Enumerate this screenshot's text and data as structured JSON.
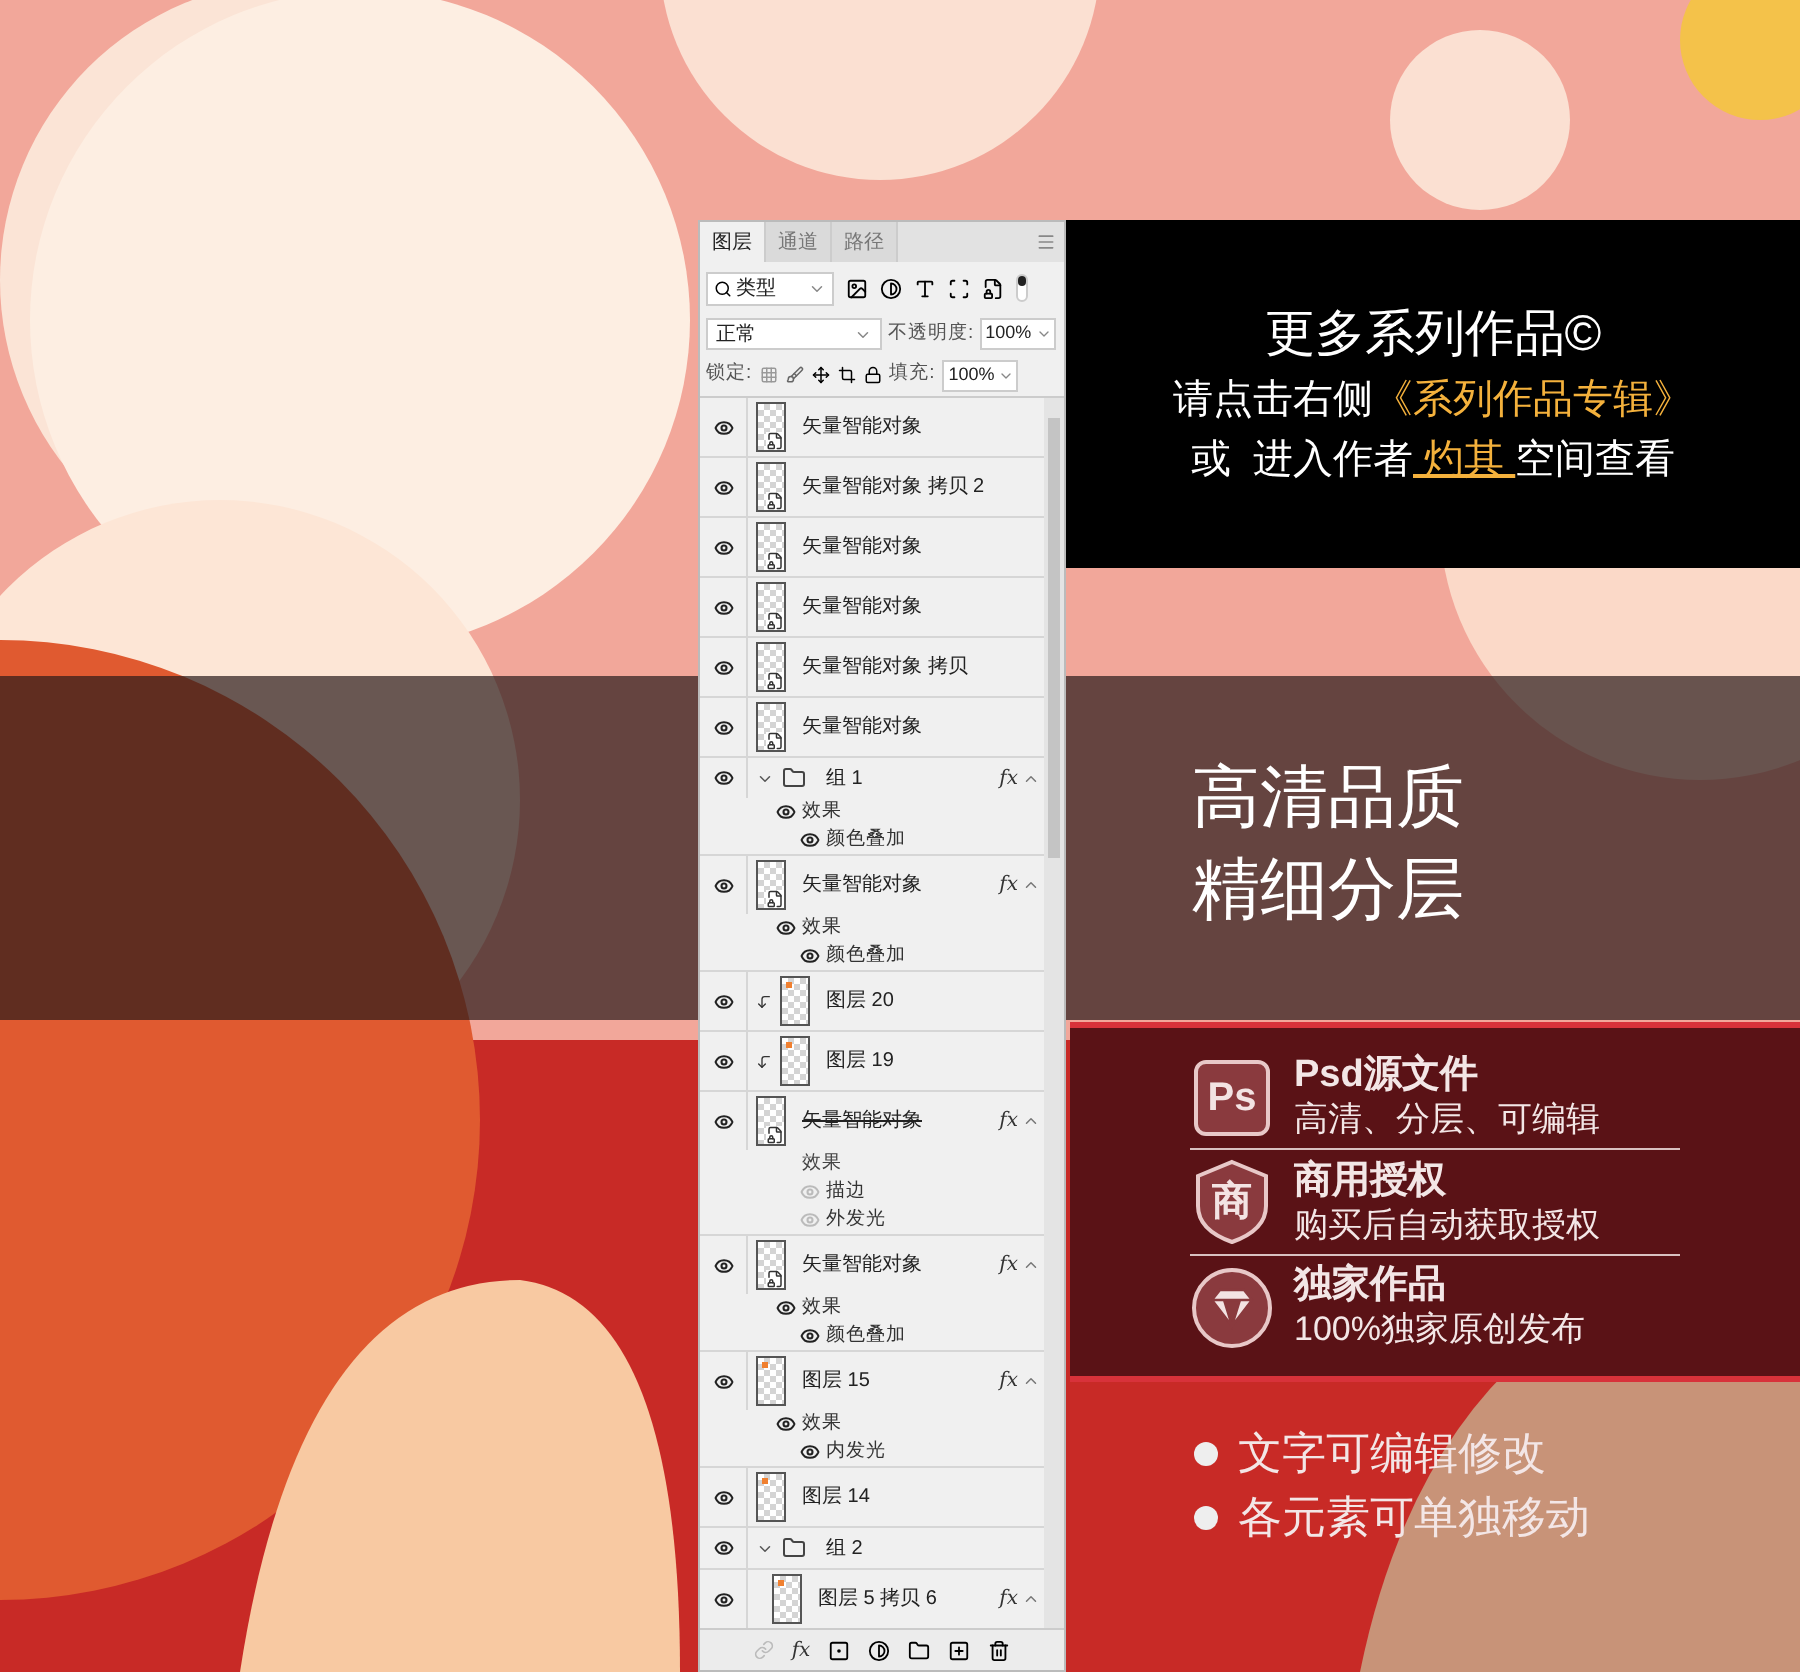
{
  "layers_panel": {
    "tabs": [
      {
        "label": "图层",
        "selected": true
      },
      {
        "label": "通道",
        "selected": false
      },
      {
        "label": "路径",
        "selected": false
      }
    ],
    "filter": {
      "value": "类型"
    },
    "blend_mode": "正常",
    "opacity_label": "不透明度:",
    "opacity": "100%",
    "lock_label": "锁定:",
    "fill_label": "填充:",
    "fill": "100%",
    "layers": [
      {
        "kind": "smart",
        "name": "矢量智能对象",
        "visible": true
      },
      {
        "kind": "smart",
        "name": "矢量智能对象 拷贝 2",
        "visible": true
      },
      {
        "kind": "smart",
        "name": "矢量智能对象",
        "visible": true
      },
      {
        "kind": "smart",
        "name": "矢量智能对象",
        "visible": true
      },
      {
        "kind": "smart",
        "name": "矢量智能对象 拷贝",
        "visible": true
      },
      {
        "kind": "smart",
        "name": "矢量智能对象",
        "visible": true
      },
      {
        "kind": "group",
        "name": "组 1",
        "visible": true,
        "expanded": true,
        "fx": "fx",
        "effects": {
          "label": "效果",
          "visible": true,
          "items": [
            {
              "name": "颜色叠加",
              "visible": true
            }
          ]
        }
      },
      {
        "kind": "smart",
        "name": "矢量智能对象",
        "visible": true,
        "fx": "fx",
        "effects": {
          "label": "效果",
          "visible": true,
          "items": [
            {
              "name": "颜色叠加",
              "visible": true
            }
          ]
        }
      },
      {
        "kind": "layer",
        "name": "图层 20",
        "visible": true,
        "clipped": true
      },
      {
        "kind": "layer",
        "name": "图层 19",
        "visible": true,
        "clipped": true
      },
      {
        "kind": "smart",
        "name": "矢量智能对象",
        "visible": true,
        "struck": true,
        "fx": "fx",
        "effects": {
          "label": "效果",
          "visible": false,
          "items": [
            {
              "name": "描边",
              "visible": false
            },
            {
              "name": "外发光",
              "visible": false
            }
          ]
        }
      },
      {
        "kind": "smart",
        "name": "矢量智能对象",
        "visible": true,
        "fx": "fx",
        "effects": {
          "label": "效果",
          "visible": true,
          "items": [
            {
              "name": "颜色叠加",
              "visible": true
            }
          ]
        }
      },
      {
        "kind": "layer",
        "name": "图层 15",
        "visible": true,
        "fx": "fx",
        "effects": {
          "label": "效果",
          "visible": true,
          "items": [
            {
              "name": "内发光",
              "visible": true
            }
          ]
        }
      },
      {
        "kind": "layer",
        "name": "图层 14",
        "visible": true
      },
      {
        "kind": "group",
        "name": "组 2",
        "visible": true,
        "expanded": true,
        "children": [
          {
            "kind": "layer",
            "name": "图层 5 拷贝 6",
            "visible": true,
            "fx": "fx"
          }
        ]
      }
    ],
    "footer": {
      "fx_label": "fx"
    }
  },
  "promo": {
    "title": "更多系列作品©",
    "line_2": {
      "text": "请点击右侧",
      "highlight": "《系列作品专辑》"
    },
    "line_3": {
      "before": "或  进入作者",
      "author": " 灼其 ",
      "after": "空间查看"
    }
  },
  "headline": [
    "高清品质",
    "精细分层"
  ],
  "features": [
    {
      "kind": "ps",
      "badge": "Ps",
      "title": "Psd源文件",
      "subtitle": "高清、分层、可编辑"
    },
    {
      "kind": "shield",
      "badge": "商",
      "title": "商用授权",
      "subtitle": "购买后自动获取授权"
    },
    {
      "kind": "diamond",
      "title": "独家作品",
      "subtitle": "100%独家原创发布"
    }
  ],
  "bullets": [
    "文字可编辑修改",
    "各元素可单独移动"
  ]
}
